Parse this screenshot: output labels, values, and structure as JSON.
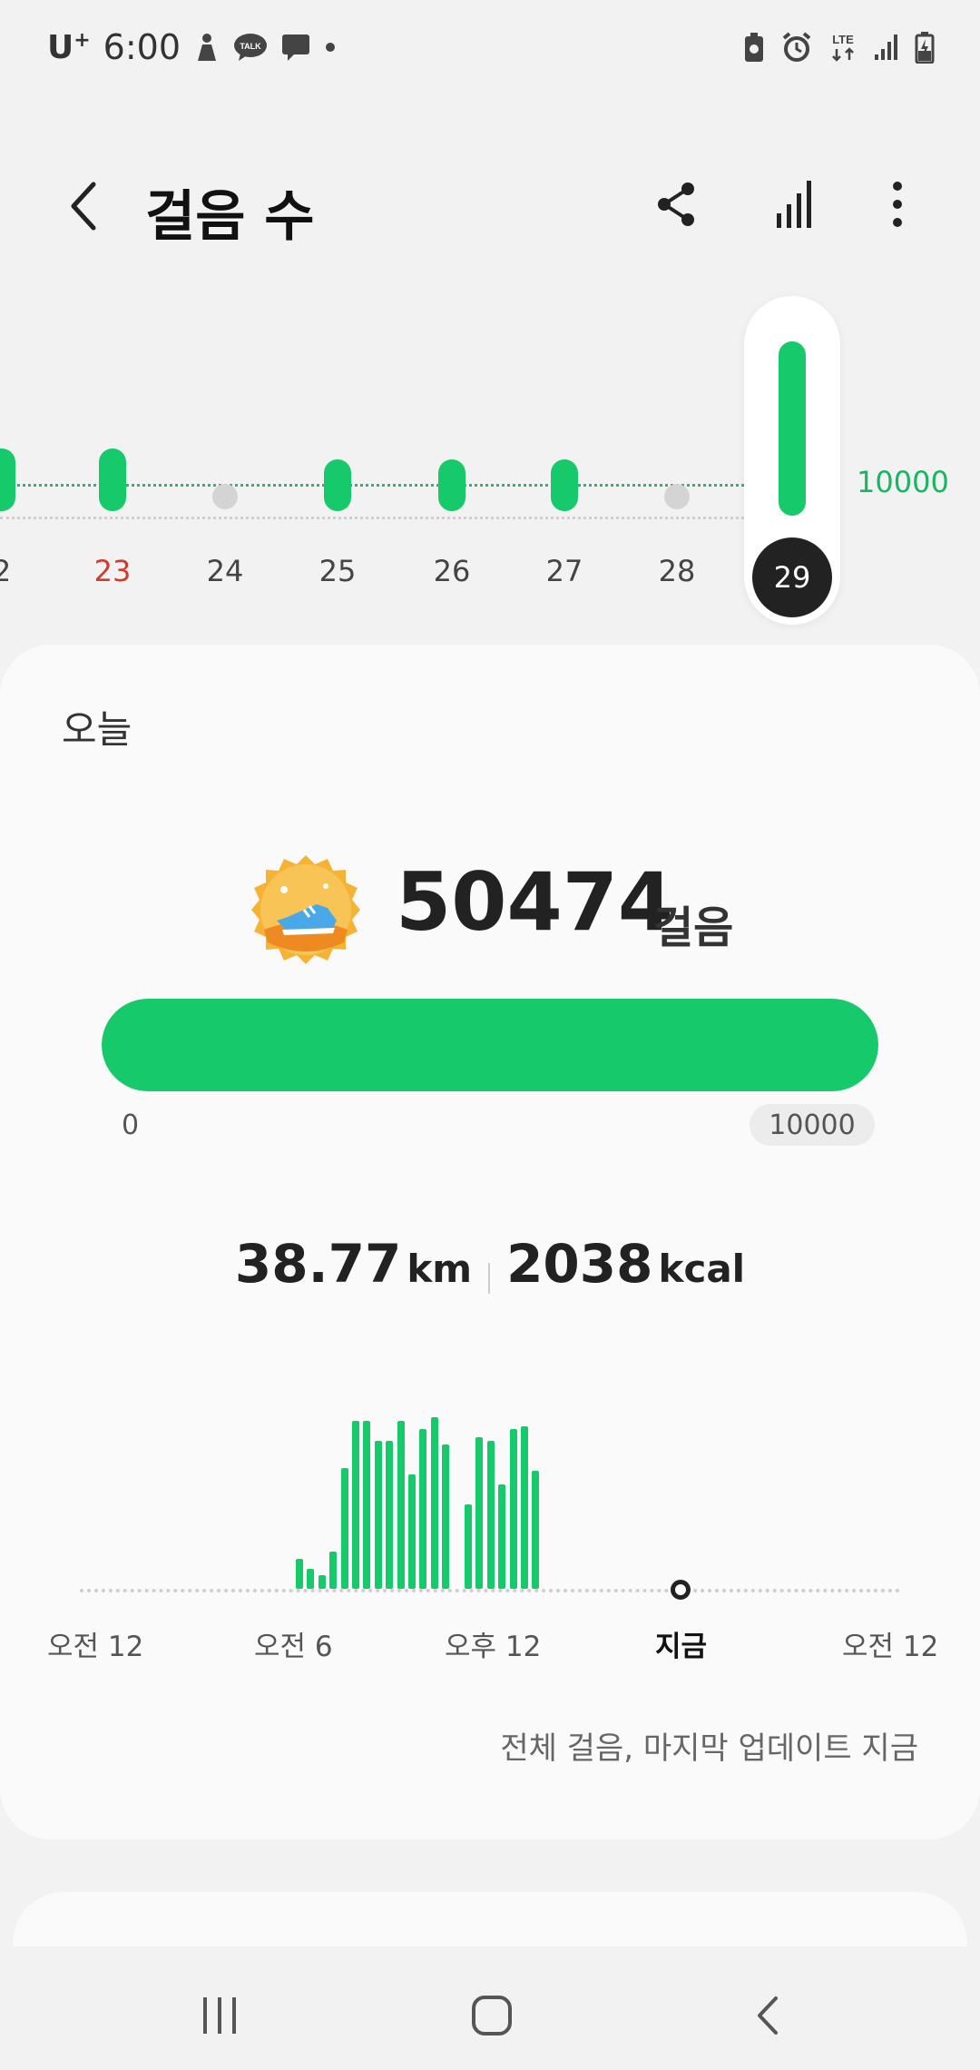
{
  "status_bar": {
    "carrier": "U",
    "carrier_sup": "+",
    "time": "6:00",
    "network": "LTE"
  },
  "header": {
    "title": "걸음 수"
  },
  "week": {
    "goal_label": "10000",
    "days": [
      {
        "label": "2",
        "steps_fraction": 0.55,
        "holiday": false
      },
      {
        "label": "23",
        "steps_fraction": 0.55,
        "holiday": true
      },
      {
        "label": "24",
        "steps_fraction": 0,
        "holiday": false
      },
      {
        "label": "25",
        "steps_fraction": 0.35,
        "holiday": false
      },
      {
        "label": "26",
        "steps_fraction": 0.35,
        "holiday": false
      },
      {
        "label": "27",
        "steps_fraction": 0.35,
        "holiday": false
      },
      {
        "label": "28",
        "steps_fraction": 0,
        "holiday": false
      }
    ],
    "selected_day": "29"
  },
  "today": {
    "label": "오늘",
    "steps": "50474",
    "steps_unit": "걸음",
    "progress_fraction": 1.0,
    "progress_min": "0",
    "progress_max": "10000",
    "distance": "38.77",
    "distance_unit": "km",
    "calories": "2038",
    "calories_unit": "kcal",
    "time_labels": [
      "오전 12",
      "오전 6",
      "오후 12",
      "지금",
      "오전 12"
    ],
    "update_note": "전체 걸음, 마지막 업데이트 지금"
  },
  "hourly_bars": [
    0.18,
    0.12,
    0.08,
    0.22,
    0.72,
    1.0,
    1.0,
    0.88,
    0.88,
    1.0,
    0.68,
    0.95,
    1.02,
    0.86,
    0.0,
    0.5,
    0.9,
    0.88,
    0.62,
    0.95,
    0.97,
    0.7
  ],
  "colors": {
    "accent": "#16c96b",
    "holiday": "#d23a2e",
    "selected": "#222222"
  }
}
